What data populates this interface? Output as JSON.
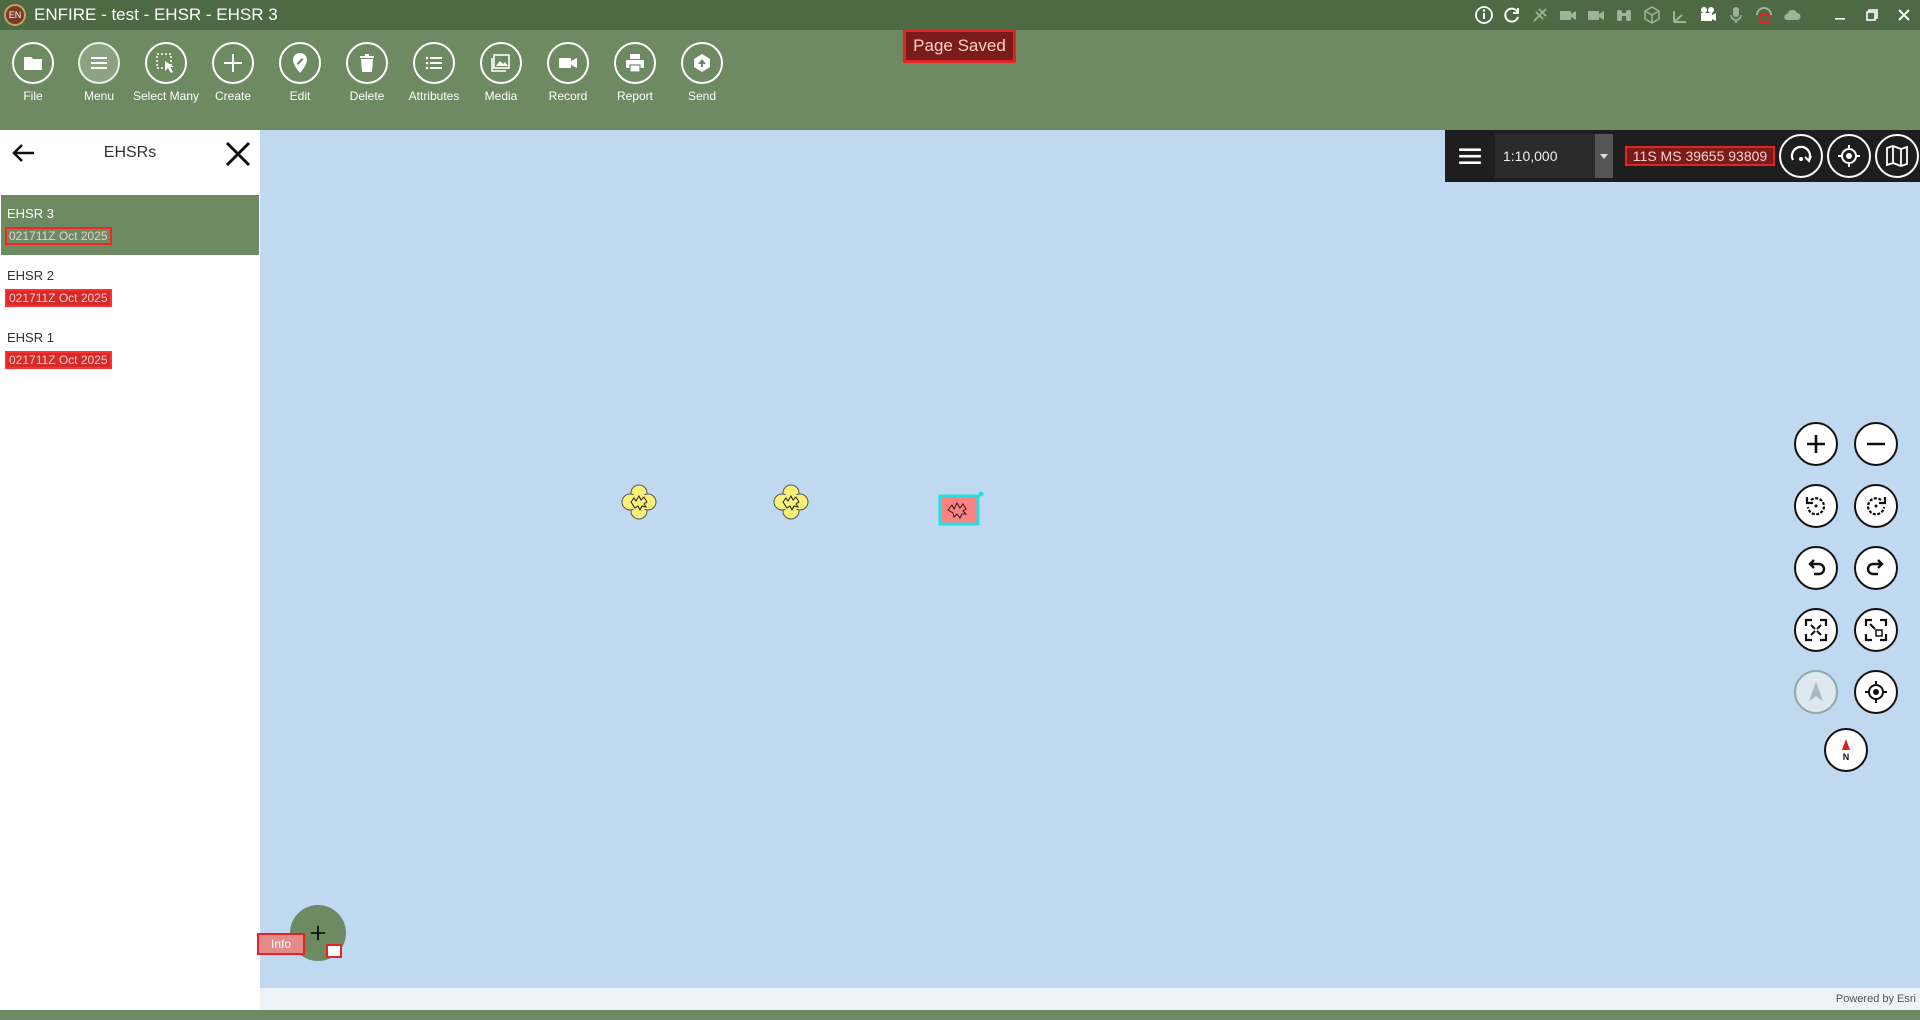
{
  "window": {
    "title": "ENFIRE - test - EHSR - EHSR 3",
    "logo_text": "EN"
  },
  "status_toast": "Page Saved",
  "toolbar": [
    {
      "label": "File",
      "icon": "folder-icon"
    },
    {
      "label": "Menu",
      "icon": "hamburger-icon"
    },
    {
      "label": "Select Many",
      "icon": "select-many-icon"
    },
    {
      "label": "Create",
      "icon": "plus-icon"
    },
    {
      "label": "Edit",
      "icon": "pin-edit-icon"
    },
    {
      "label": "Delete",
      "icon": "trash-icon"
    },
    {
      "label": "Attributes",
      "icon": "list-icon"
    },
    {
      "label": "Media",
      "icon": "image-icon"
    },
    {
      "label": "Record",
      "icon": "video-icon"
    },
    {
      "label": "Report",
      "icon": "printer-icon"
    },
    {
      "label": "Send",
      "icon": "send-icon"
    }
  ],
  "sidebar": {
    "title": "EHSRs",
    "items": [
      {
        "name": "EHSR 3",
        "date": "021711Z Oct 2025",
        "selected": true
      },
      {
        "name": "EHSR 2",
        "date": "021711Z Oct 2025",
        "selected": false
      },
      {
        "name": "EHSR 1",
        "date": "021711Z Oct 2025",
        "selected": false
      }
    ]
  },
  "map": {
    "scale": "1:10,000",
    "coordinate": "11S MS 39655 93809",
    "attribution": "Powered by Esri",
    "fab_label": "Info",
    "north_label": "N"
  },
  "colors": {
    "titlebar": "#4e6a44",
    "toolbar": "#6e8a62",
    "map_water": "#c0d8f0",
    "alert_red": "#e32424"
  }
}
